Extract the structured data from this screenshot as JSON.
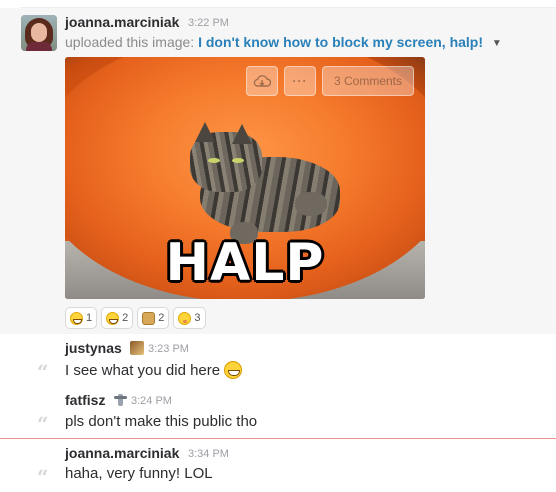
{
  "upload_message": {
    "author": "joanna.marciniak",
    "time": "3:22 PM",
    "action_text": "uploaded this image:",
    "file_title": "I don't know how to block my screen, halp!",
    "image_caption": "HALP",
    "comments_label": "3 Comments",
    "reactions": [
      {
        "emoji": "grinning-face-icon",
        "count": "1"
      },
      {
        "emoji": "tears-of-joy-icon",
        "count": "2"
      },
      {
        "emoji": "doge-icon",
        "count": "2"
      },
      {
        "emoji": "shushing-face-icon",
        "count": "3"
      }
    ]
  },
  "comments": [
    {
      "author": "justynas",
      "status_icon": "cat-status-icon",
      "time": "3:23 PM",
      "text": "I see what you did here",
      "inline_emoji": "smile-icon"
    },
    {
      "author": "fatfisz",
      "status_icon": "unicorn-status-icon",
      "time": "3:24 PM",
      "text": "pls don't make this public tho"
    },
    {
      "author": "joanna.marciniak",
      "time": "3:34 PM",
      "text": "haha, very funny! LOL"
    }
  ],
  "colors": {
    "link": "#2a80b9",
    "new_messages_divider": "#ee9494",
    "upload_background": "#f6f6f6"
  }
}
